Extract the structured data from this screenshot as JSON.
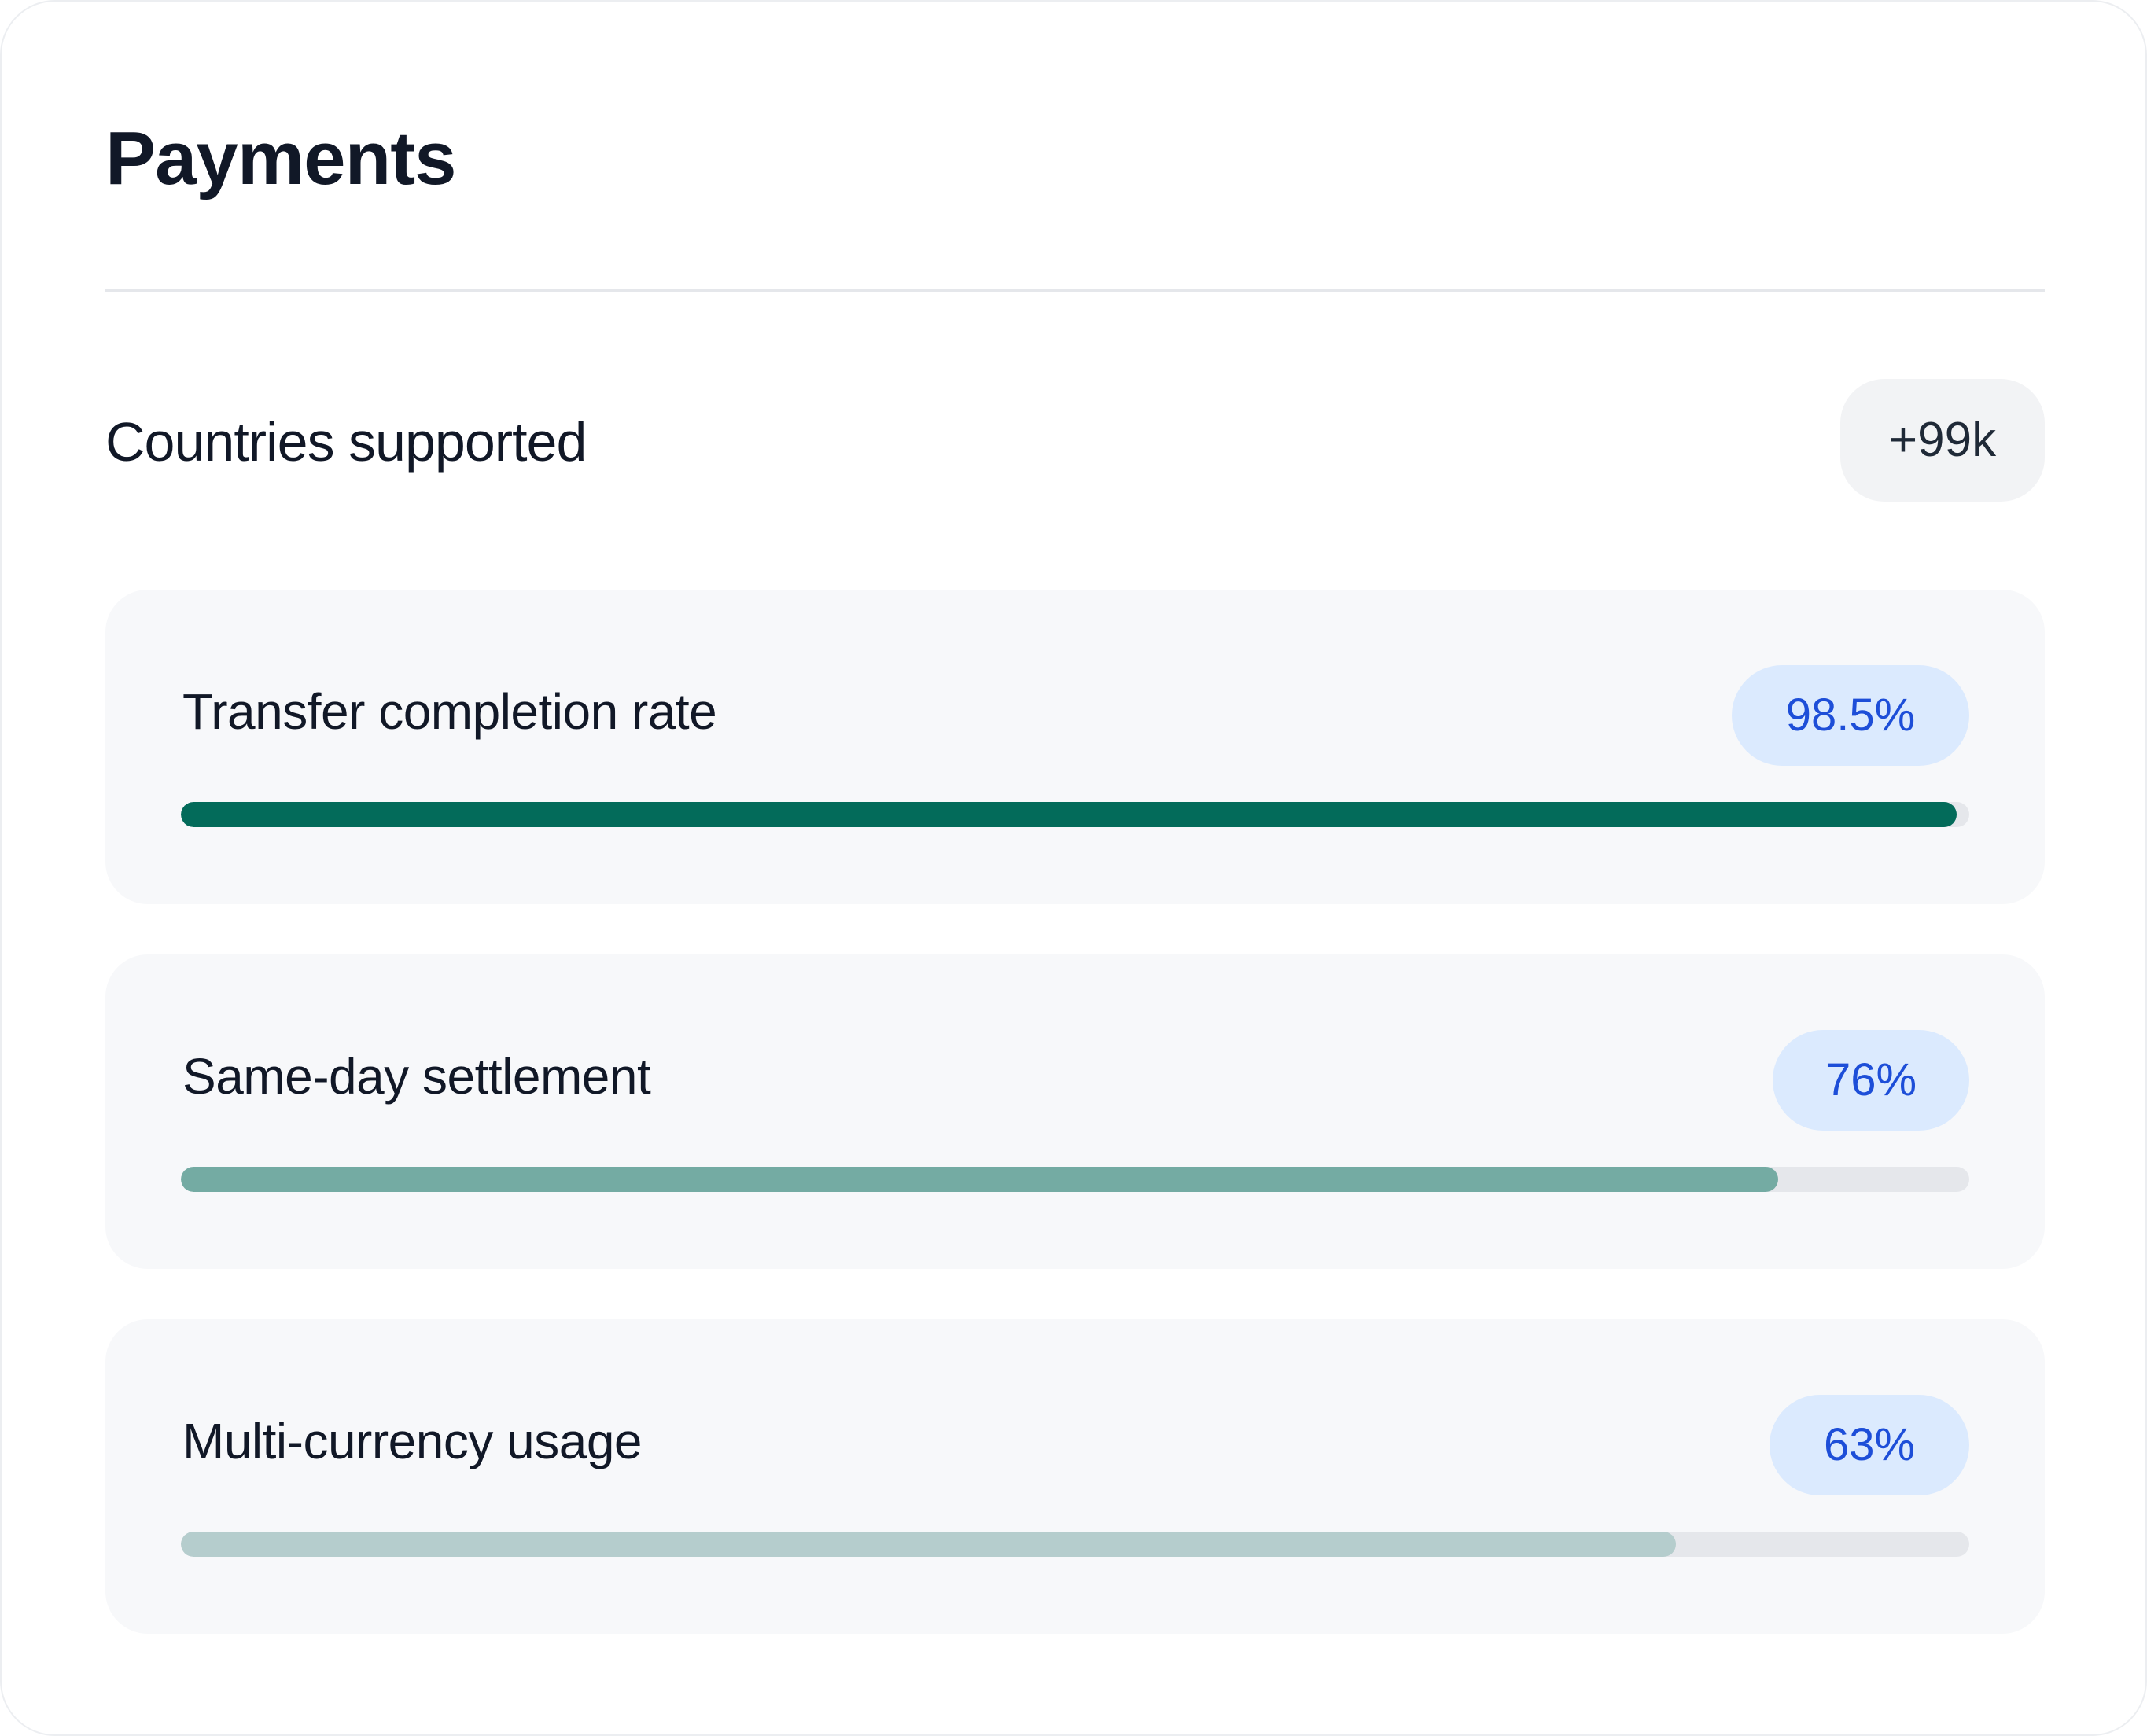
{
  "header": {
    "title": "Payments"
  },
  "countries": {
    "label": "Countries supported",
    "value": "+99k"
  },
  "metrics": [
    {
      "label": "Transfer completion rate",
      "value": "98.5%",
      "fill_fraction": 0.993,
      "color": "#036b5a"
    },
    {
      "label": "Same-day settlement",
      "value": "76%",
      "fill_fraction": 0.893,
      "color": "#74aba3"
    },
    {
      "label": "Multi-currency usage",
      "value": "63%",
      "fill_fraction": 0.836,
      "color": "#b5cdcd"
    }
  ]
}
